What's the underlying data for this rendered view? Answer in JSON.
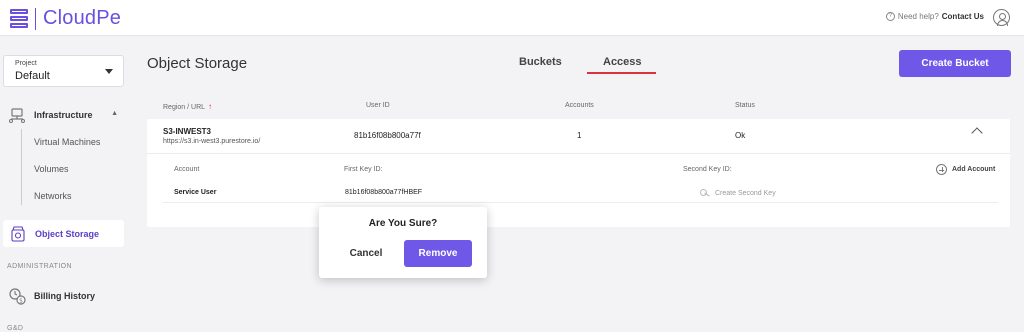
{
  "app": {
    "name": "CloudPe"
  },
  "header": {
    "help_text": "Need help?",
    "contact_label": "Contact Us"
  },
  "sidebar": {
    "project_label": "Project",
    "project_value": "Default",
    "infrastructure_label": "Infrastructure",
    "sub_items": [
      "Virtual Machines",
      "Volumes",
      "Networks"
    ],
    "object_storage_label": "Object Storage",
    "administration_title": "ADMINISTRATION",
    "billing_label": "Billing History",
    "next_section_title": "G&D"
  },
  "main": {
    "title": "Object Storage",
    "tabs": [
      "Buckets",
      "Access"
    ],
    "active_tab": "Access",
    "create_bucket_label": "Create Bucket",
    "table": {
      "headers": [
        "Region / URL",
        "User ID",
        "Accounts",
        "Status"
      ],
      "sort_indicator": "↑",
      "row": {
        "region_name": "S3-INWEST3",
        "region_url": "https://s3.in-west3.purestore.io/",
        "user_id": "81b16f08b800a77f",
        "accounts": "1",
        "status": "Ok"
      },
      "sub_headers": [
        "Account",
        "First Key ID:",
        "Second Key ID:"
      ],
      "add_account_label": "Add Account",
      "sub_row": {
        "account": "Service User",
        "first_key": "81b16f08b800a77fHBEF",
        "second_key_action": "Create Second Key"
      }
    }
  },
  "dialog": {
    "title": "Are You Sure?",
    "cancel_label": "Cancel",
    "remove_label": "Remove"
  },
  "colors": {
    "accent": "#6f57e8",
    "tab_underline": "#d9323c",
    "brand": "#6b4fe0"
  }
}
